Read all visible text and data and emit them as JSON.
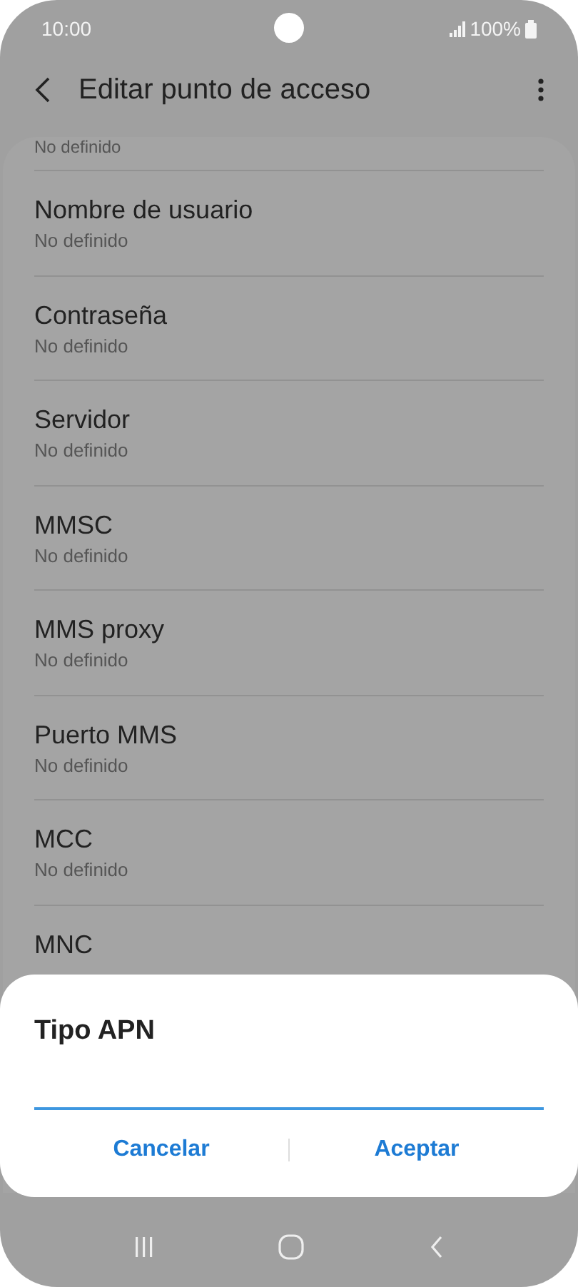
{
  "status_bar": {
    "time": "10:00",
    "battery": "100%"
  },
  "header": {
    "title": "Editar punto de acceso"
  },
  "top_partial_value": "No definido",
  "settings": [
    {
      "label": "Nombre de usuario",
      "value": "No definido"
    },
    {
      "label": "Contraseña",
      "value": "No definido"
    },
    {
      "label": "Servidor",
      "value": "No definido"
    },
    {
      "label": "MMSC",
      "value": "No definido"
    },
    {
      "label": "MMS proxy",
      "value": "No definido"
    },
    {
      "label": "Puerto MMS",
      "value": "No definido"
    },
    {
      "label": "MCC",
      "value": "No definido"
    },
    {
      "label": "MNC"
    }
  ],
  "dialog": {
    "title": "Tipo APN",
    "buttons": [
      "Cancelar",
      "Aceptar"
    ]
  }
}
